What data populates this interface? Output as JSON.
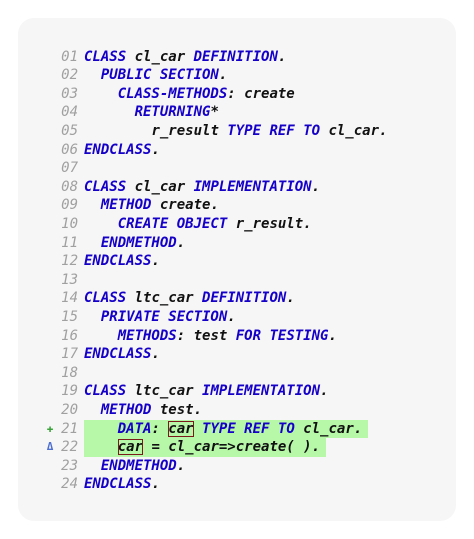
{
  "editor": {
    "lines": [
      {
        "num": "01",
        "indent": "",
        "tokens": [
          [
            "kw",
            "CLASS"
          ],
          [
            "t",
            " cl_car "
          ],
          [
            "kw",
            "DEFINITION"
          ],
          [
            "t",
            "."
          ]
        ]
      },
      {
        "num": "02",
        "indent": "  ",
        "tokens": [
          [
            "kw",
            "PUBLIC SECTION"
          ],
          [
            "t",
            "."
          ]
        ]
      },
      {
        "num": "03",
        "indent": "    ",
        "tokens": [
          [
            "kw",
            "CLASS-METHODS"
          ],
          [
            "t",
            ": create"
          ]
        ]
      },
      {
        "num": "04",
        "indent": "      ",
        "tokens": [
          [
            "kw",
            "RETURNING"
          ],
          [
            "t",
            "*"
          ]
        ]
      },
      {
        "num": "05",
        "indent": "        ",
        "tokens": [
          [
            "t",
            "r_result "
          ],
          [
            "kw",
            "TYPE REF TO"
          ],
          [
            "t",
            " cl_car."
          ]
        ]
      },
      {
        "num": "06",
        "indent": "",
        "tokens": [
          [
            "kw",
            "ENDCLASS"
          ],
          [
            "t",
            "."
          ]
        ]
      },
      {
        "num": "07",
        "indent": "",
        "tokens": []
      },
      {
        "num": "08",
        "indent": "",
        "tokens": [
          [
            "kw",
            "CLASS"
          ],
          [
            "t",
            " cl_car "
          ],
          [
            "kw",
            "IMPLEMENTATION"
          ],
          [
            "t",
            "."
          ]
        ]
      },
      {
        "num": "09",
        "indent": "  ",
        "tokens": [
          [
            "kw",
            "METHOD"
          ],
          [
            "t",
            " create."
          ]
        ]
      },
      {
        "num": "10",
        "indent": "    ",
        "tokens": [
          [
            "kw",
            "CREATE OBJECT"
          ],
          [
            "t",
            " r_result."
          ]
        ]
      },
      {
        "num": "11",
        "indent": "  ",
        "tokens": [
          [
            "kw",
            "ENDMETHOD"
          ],
          [
            "t",
            "."
          ]
        ]
      },
      {
        "num": "12",
        "indent": "",
        "tokens": [
          [
            "kw",
            "ENDCLASS"
          ],
          [
            "t",
            "."
          ]
        ]
      },
      {
        "num": "13",
        "indent": "",
        "tokens": []
      },
      {
        "num": "14",
        "indent": "",
        "tokens": [
          [
            "kw",
            "CLASS"
          ],
          [
            "t",
            " ltc_car "
          ],
          [
            "kw",
            "DEFINITION"
          ],
          [
            "t",
            "."
          ]
        ]
      },
      {
        "num": "15",
        "indent": "  ",
        "tokens": [
          [
            "kw",
            "PRIVATE SECTION"
          ],
          [
            "t",
            "."
          ]
        ]
      },
      {
        "num": "16",
        "indent": "    ",
        "tokens": [
          [
            "kw",
            "METHODS"
          ],
          [
            "t",
            ": test "
          ],
          [
            "kw",
            "FOR TESTING"
          ],
          [
            "t",
            "."
          ]
        ]
      },
      {
        "num": "17",
        "indent": "",
        "tokens": [
          [
            "kw",
            "ENDCLASS"
          ],
          [
            "t",
            "."
          ]
        ]
      },
      {
        "num": "18",
        "indent": "",
        "tokens": []
      },
      {
        "num": "19",
        "indent": "",
        "tokens": [
          [
            "kw",
            "CLASS"
          ],
          [
            "t",
            " ltc_car "
          ],
          [
            "kw",
            "IMPLEMENTATION"
          ],
          [
            "t",
            "."
          ]
        ]
      },
      {
        "num": "20",
        "indent": "  ",
        "tokens": [
          [
            "kw",
            "METHOD"
          ],
          [
            "t",
            " test."
          ]
        ]
      },
      {
        "num": "21",
        "indent": "    ",
        "marker": "add",
        "marker_glyph": "✚",
        "highlight": true,
        "tokens": [
          [
            "kw",
            "DATA"
          ],
          [
            "t",
            ": "
          ],
          [
            "box",
            "car"
          ],
          [
            "t",
            " "
          ],
          [
            "kw",
            "TYPE REF TO"
          ],
          [
            "t",
            " cl_car."
          ]
        ]
      },
      {
        "num": "22",
        "indent": "    ",
        "marker": "chg",
        "marker_glyph": "Δ",
        "highlight": true,
        "tokens": [
          [
            "box",
            "car"
          ],
          [
            "t",
            " = cl_car=>create( )."
          ]
        ]
      },
      {
        "num": "23",
        "indent": "  ",
        "tokens": [
          [
            "kw",
            "ENDMETHOD"
          ],
          [
            "t",
            "."
          ]
        ]
      },
      {
        "num": "24",
        "indent": "",
        "tokens": [
          [
            "kw",
            "ENDCLASS"
          ],
          [
            "t",
            "."
          ]
        ]
      }
    ],
    "colors": {
      "keyword": "#1500c8",
      "text": "#111111",
      "line_number": "#a0a0a0",
      "highlight": "#b6f7a8",
      "box_outline": "#7b1a1a",
      "added_marker": "#3aa33a",
      "changed_marker": "#4d6fd1"
    }
  }
}
